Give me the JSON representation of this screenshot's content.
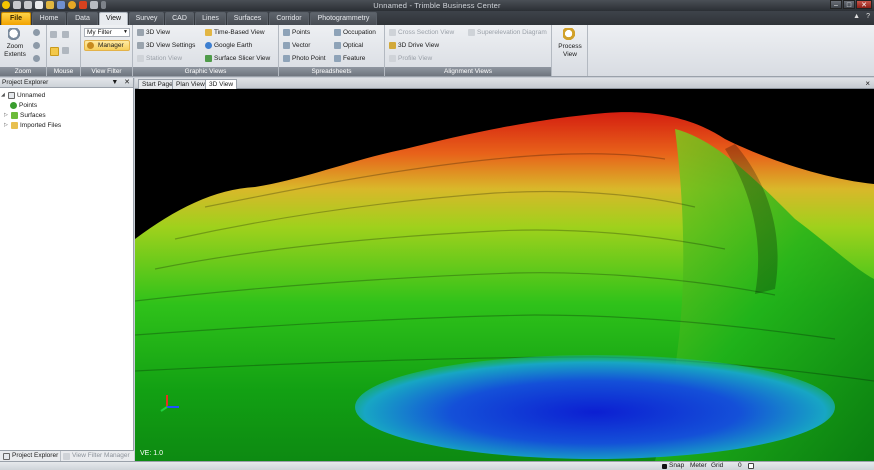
{
  "window": {
    "title": "Unnamed - Trimble Business Center",
    "controls": [
      "–",
      "□",
      "✕"
    ]
  },
  "ribbon_tabs": [
    {
      "label": "File"
    },
    {
      "label": "Home"
    },
    {
      "label": "Data"
    },
    {
      "label": "View"
    },
    {
      "label": "Survey"
    },
    {
      "label": "CAD"
    },
    {
      "label": "Lines"
    },
    {
      "label": "Surfaces"
    },
    {
      "label": "Corridor"
    },
    {
      "label": "Photogrammetry"
    }
  ],
  "active_tab": "View",
  "ribbon_right": [
    "▲",
    "?"
  ],
  "ribbon": {
    "zoom": {
      "label": "Zoom",
      "zoom_extents": "Zoom Extents"
    },
    "mouse": {
      "label": "Mouse"
    },
    "view_filter": {
      "label": "View Filter",
      "selected_filter": "My Filter",
      "manager": "Manager"
    },
    "graphic_views": {
      "label": "Graphic Views",
      "items": [
        "3D View",
        "3D View Settings",
        "Station View",
        "Time-Based View",
        "Google Earth",
        "Surface Slicer View"
      ]
    },
    "spreadsheets": {
      "label": "Spreadsheets",
      "items": [
        "Points",
        "Vector",
        "Photo Point",
        "Occupation",
        "Optical",
        "Feature"
      ]
    },
    "alignment_views": {
      "label": "Alignment Views",
      "items": [
        "Cross Section View",
        "3D Drive View",
        "Profile View",
        "Superelevation Diagram"
      ]
    },
    "process_view": {
      "label": "Process View"
    }
  },
  "project_explorer": {
    "title": "Project Explorer",
    "header_buttons": [
      "▼",
      "✕"
    ],
    "root": "Unnamed",
    "items": [
      "Points",
      "Surfaces",
      "Imported Files"
    ],
    "bottom_tabs": [
      "Project Explorer",
      "View Filter Manager"
    ]
  },
  "document_tabs": [
    "Start Page",
    "Plan View",
    "3D View"
  ],
  "active_document": "3D View",
  "viewer": {
    "vertical_exaggeration": "VE: 1.0"
  },
  "status_bar": {
    "snap": "Snap",
    "units": "Meter",
    "grid": "Grid",
    "value": "0"
  },
  "colors": {
    "accent_file": "#f2a300",
    "terrain_high": "#c81e14",
    "terrain_mid": "#9acd1a",
    "terrain_low": "#1a3fd0"
  }
}
